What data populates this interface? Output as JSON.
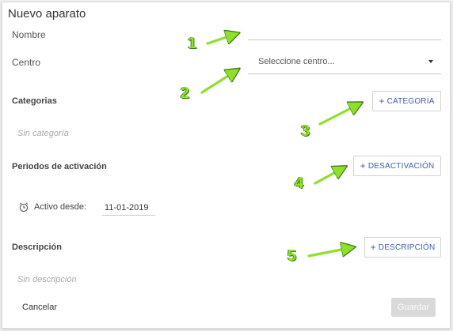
{
  "dialog": {
    "title": "Nuevo aparato",
    "nombre_label": "Nombre",
    "nombre_value": "",
    "centro_label": "Centro",
    "centro_placeholder": "Seleccione centro...",
    "categorias_title": "Categorias",
    "categoria_button": "CATEGORÍA",
    "sin_categoria": "Sin categoría",
    "periodos_title": "Periodos de activación",
    "desactivacion_button": "DESACTIVACIÓN",
    "activo_desde_label": "Activo desde:",
    "activo_desde_value": "11-01-2019",
    "descripcion_title": "Descripción",
    "descripcion_button": "DESCRIPCIÓN",
    "sin_descripcion": "Sin descripción",
    "cancel_label": "Cancelar",
    "save_label": "Guardar"
  },
  "callouts": [
    "1",
    "2",
    "3",
    "4",
    "5"
  ],
  "colors": {
    "accent": "#3f5fa8",
    "arrow": "#8ee02a",
    "disabled": "#d9d9d9"
  }
}
